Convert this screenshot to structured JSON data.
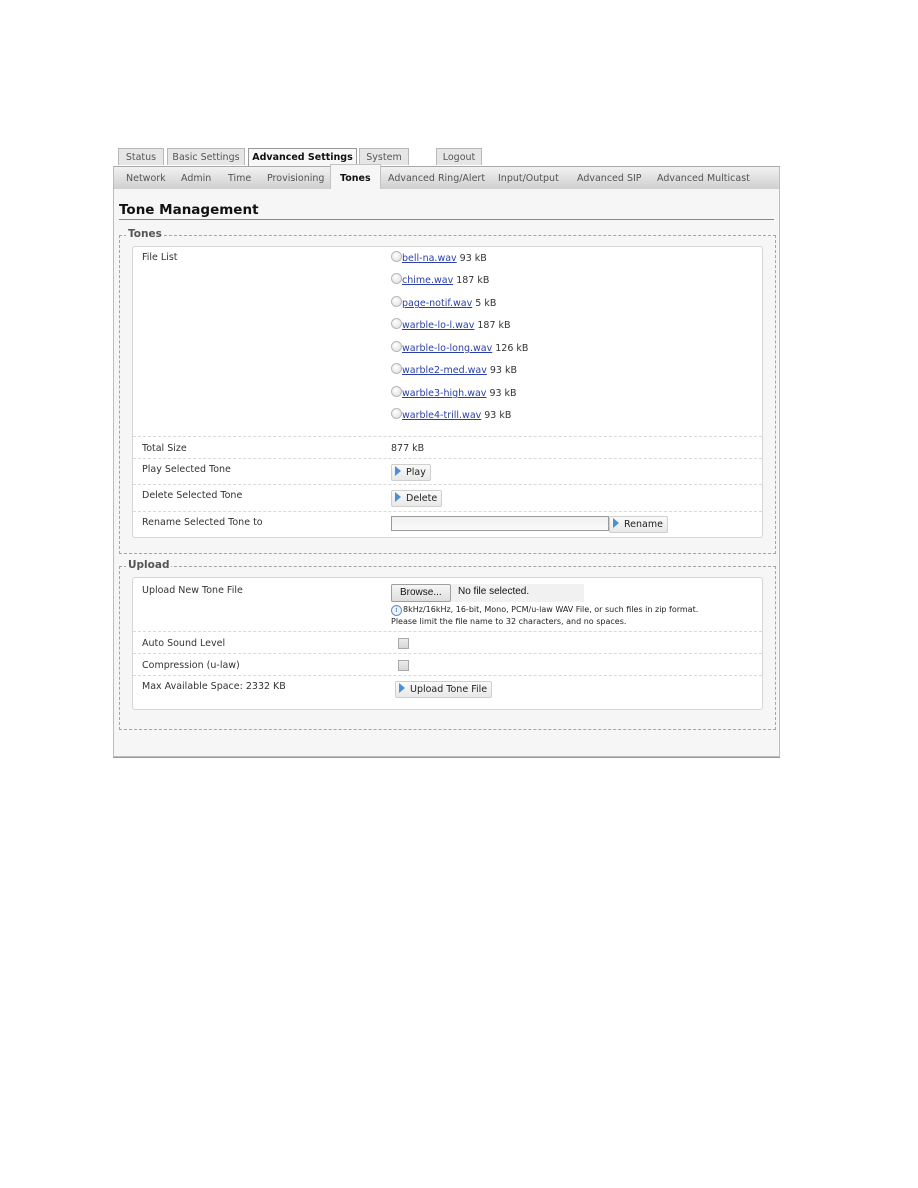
{
  "top_tabs": [
    {
      "label": "Status",
      "active": false
    },
    {
      "label": "Basic Settings",
      "active": false
    },
    {
      "label": "Advanced Settings",
      "active": true
    },
    {
      "label": "System",
      "active": false
    },
    {
      "label": "Logout",
      "active": false
    }
  ],
  "sub_tabs": [
    {
      "label": "Network",
      "active": false
    },
    {
      "label": "Admin",
      "active": false
    },
    {
      "label": "Time",
      "active": false
    },
    {
      "label": "Provisioning",
      "active": false
    },
    {
      "label": "Tones",
      "active": true
    },
    {
      "label": "Advanced Ring/Alert",
      "active": false
    },
    {
      "label": "Input/Output",
      "active": false
    },
    {
      "label": "Advanced SIP",
      "active": false
    },
    {
      "label": "Advanced Multicast",
      "active": false
    }
  ],
  "page_title": "Tone Management",
  "tones": {
    "legend": "Tones",
    "file_list_label": "File List",
    "files": [
      {
        "name": "bell-na.wav",
        "size": "93 kB",
        "selected": false
      },
      {
        "name": "chime.wav",
        "size": "187 kB",
        "selected": false
      },
      {
        "name": "page-notif.wav",
        "size": "5 kB",
        "selected": false
      },
      {
        "name": "warble-lo-l.wav",
        "size": "187 kB",
        "selected": false
      },
      {
        "name": "warble-lo-long.wav",
        "size": "126 kB",
        "selected": false
      },
      {
        "name": "warble2-med.wav",
        "size": "93 kB",
        "selected": false
      },
      {
        "name": "warble3-high.wav",
        "size": "93 kB",
        "selected": false
      },
      {
        "name": "warble4-trill.wav",
        "size": "93 kB",
        "selected": false
      }
    ],
    "total_size_label": "Total Size",
    "total_size_value": "877 kB",
    "play_label": "Play Selected Tone",
    "play_button": "Play",
    "delete_label": "Delete Selected Tone",
    "delete_button": "Delete",
    "rename_label": "Rename Selected Tone to",
    "rename_value": "",
    "rename_button": "Rename"
  },
  "upload": {
    "legend": "Upload",
    "upload_label": "Upload New Tone File",
    "browse_button": "Browse...",
    "no_file_text": "No file selected.",
    "hint_line1": "8kHz/16kHz, 16-bit, Mono, PCM/u-law WAV File, or such files in zip format.",
    "hint_line2": "Please limit the file name to 32 characters, and no spaces.",
    "auto_sound_label": "Auto Sound Level",
    "auto_sound_checked": false,
    "compression_label": "Compression (u-law)",
    "compression_checked": false,
    "max_space_label": "Max Available Space: 2332 KB",
    "upload_button": "Upload Tone File"
  },
  "colors": {
    "link": "#2b3fa8",
    "button_arrow": "#4a90d9",
    "panel_bg": "#f6f6f6"
  }
}
